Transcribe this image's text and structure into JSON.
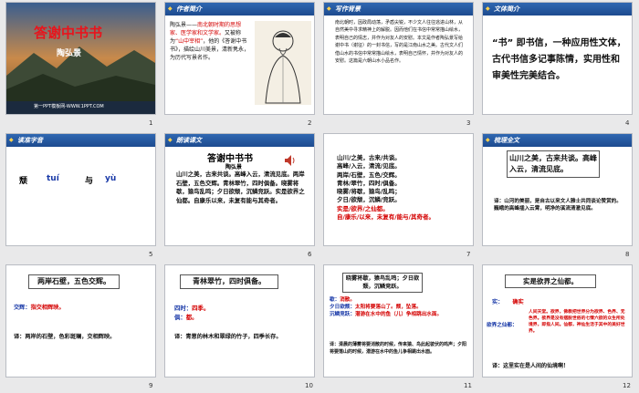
{
  "slides": [
    {
      "num": "1",
      "title": "答谢中书书",
      "author": "陶弘景",
      "footer": "第一PPT模板网-WWW.1PPT.COM"
    },
    {
      "num": "2",
      "header": "作者简介",
      "body_prefix": "陶弘景——",
      "body_red": "南北朝时期的思想家、医学家和文学家。",
      "body_a": "又被称为",
      "body_red2": "“山中宰相”",
      "body_b": "，他的《答谢中书书》，描绘山川美景，清新隽永，为历代写景名作。"
    },
    {
      "num": "3",
      "header": "写作背景",
      "body": "南北朝时，因政局动荡，矛盾尖锐，不少文人往往逃进山林，从自然美中寻求精神上的解脱。因而他们在书信中常常描山绘水，表明自己的情志，并作为对友人的安慰。本文是作者陶弘景写给谢中书（谢征）的一封书信，写的是江南山水之美。古代文人们借山水的书信中常常描山绘水，表明自己情怀，并作为对友人的安慰。这篇是六朝山水小品名作。"
    },
    {
      "num": "4",
      "header": "文体简介",
      "body": "“书” 即书信，一种应用性文体，古代书信多记事陈情，实用性和审美性完美结合。"
    },
    {
      "num": "5",
      "header": "读准字音",
      "char1": "颓",
      "pin1": "tuí",
      "word": "与",
      "pin2": "yù"
    },
    {
      "num": "6",
      "header": "朗读课文",
      "title": "答谢中书书",
      "author": "陶弘景",
      "body": "山川之美，古来共谈。高峰入云，清流见底。两岸石壁，五色交辉。青林翠竹，四时俱备。晓雾将歇，猿鸟乱鸣；夕日欲颓，沉鳞竞跃。实是欲界之仙都。自康乐以来，未复有能与其奇者。"
    },
    {
      "num": "7",
      "lines": [
        "山川/之美，古来/共谈。",
        "高峰/入云，清流/见底。",
        "两岸/石壁，五色/交辉。",
        "青林/翠竹，四时/俱备。",
        "晓雾/将歇，猿鸟/乱鸣；",
        "夕日/欲颓，沉鳞/竞跃。"
      ],
      "red_lines": [
        "实是/欲界/之仙都。",
        "自/康乐/以来，未复有/能与/其奇者。"
      ]
    },
    {
      "num": "8",
      "header": "梳理全文",
      "box": "山川之美，古来共谈。高峰入云，清流见底。",
      "note": "译：山河的美丽，是自古以来文人雅士共同谈论赞赏的。巍峨的高峰插入云霄，明净的溪流清澈见底。"
    },
    {
      "num": "9",
      "box": "两岸石壁，五色交辉。",
      "label": "交辉：",
      "label_text": "指交相辉映。",
      "note": "译：两岸的石壁，色彩斑斓，交相辉映。"
    },
    {
      "num": "10",
      "box": "青林翠竹，四时俱备。",
      "label1": "四时：",
      "val1": "四季。",
      "label2": "俱：",
      "val2": "都。",
      "note": "译：青葱的林木和翠绿的竹子，四季长存。"
    },
    {
      "num": "11",
      "box": "晓雾将歇，猿鸟乱鸣；夕日欲颓，沉鳞竞跃。",
      "l1": "歇：",
      "v1": "消散。",
      "l2": "夕日欲颓：",
      "v2": "太阳将要落山了。颓，坠落。",
      "l3": "沉鳞竞跃：",
      "v3": "潜游在水中的鱼（儿）争相跳出水面。",
      "note": "译：清晨的薄雾将要消散的时候，传来猿、鸟此起彼伏的鸣声；夕阳将要落山的时候，潜游在水中的鱼儿争相跳出水面。"
    },
    {
      "num": "12",
      "box": "实是欲界之仙都。",
      "l1": "实：",
      "v1": "确实",
      "l2": "欲界之仙都：",
      "v2": "人间天堂。欲界，佛教把世界分为欲界、色界、无色界。欲界是没有摆脱世俗的七情六欲的众生所处境界，即指人间。仙都，神仙生活于其中的美好世界。",
      "note": "译：这里实在是人间的仙境啊！"
    }
  ]
}
